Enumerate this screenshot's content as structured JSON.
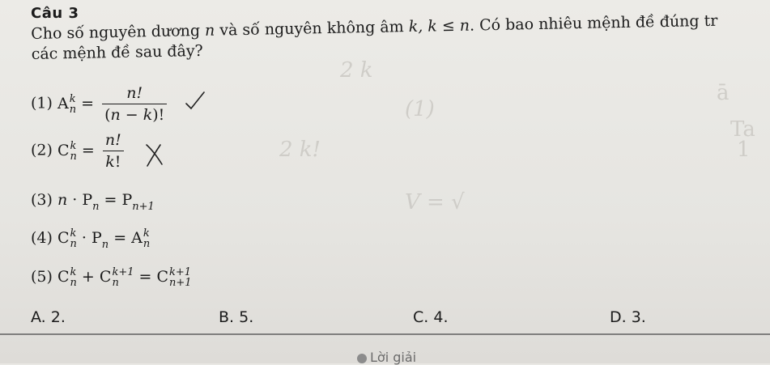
{
  "question": {
    "title": "Câu 3",
    "stem_part1": "Cho số nguyên dương ",
    "stem_n": "n",
    "stem_part2": " và số nguyên không âm ",
    "stem_k": "k, k ≤ n",
    "stem_part3": ". Có bao nhiêu mệnh đề đúng tr",
    "stem_line2": "các mệnh đề sau đây?"
  },
  "statements": [
    {
      "label": "(1)",
      "text": "A_n^k = n!/(n−k)!",
      "mark": "check"
    },
    {
      "label": "(2)",
      "text": "C_n^k = n!/k!",
      "mark": "cross"
    },
    {
      "label": "(3)",
      "text": "n · P_n = P_{n+1}",
      "mark": ""
    },
    {
      "label": "(4)",
      "text": "C_n^k · P_n = A_n^k",
      "mark": ""
    },
    {
      "label": "(5)",
      "text": "C_n^k + C_n^{k+1} = C_{n+1}^{k+1}",
      "mark": ""
    }
  ],
  "options": [
    {
      "letter": "A.",
      "value": "2."
    },
    {
      "letter": "B.",
      "value": "5."
    },
    {
      "letter": "C.",
      "value": "4."
    },
    {
      "letter": "D.",
      "value": "3."
    }
  ],
  "solution_label": "Lời giải"
}
